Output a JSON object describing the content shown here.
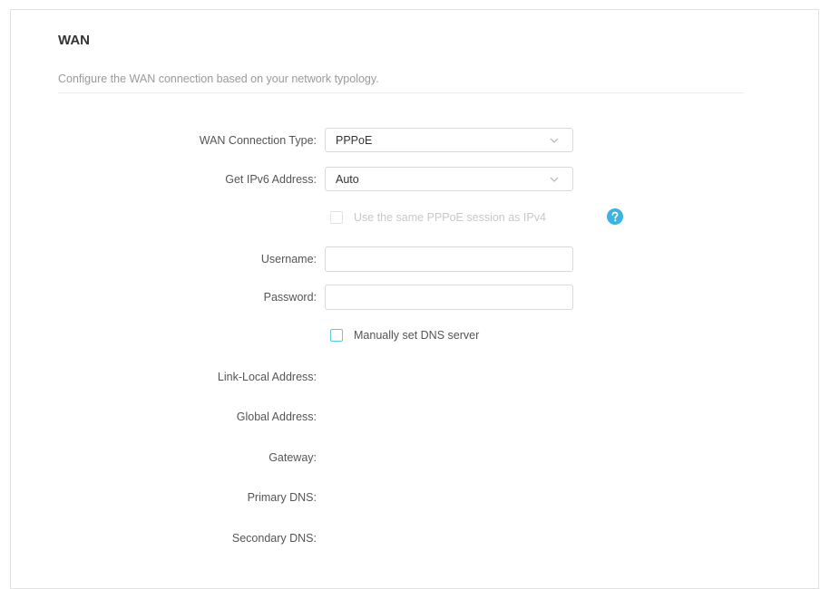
{
  "section": {
    "title": "WAN",
    "description": "Configure the WAN connection based on your network typology."
  },
  "form": {
    "connection_type": {
      "label": "WAN Connection Type:",
      "value": "PPPoE"
    },
    "ipv6_address": {
      "label": "Get IPv6 Address:",
      "value": "Auto"
    },
    "same_session": {
      "label": "Use the same PPPoE session as IPv4",
      "checked": false,
      "disabled": true
    },
    "username": {
      "label": "Username:",
      "value": ""
    },
    "password": {
      "label": "Password:",
      "value": ""
    },
    "manual_dns": {
      "label": "Manually set DNS server",
      "checked": false
    }
  },
  "status": {
    "link_local": {
      "label": "Link-Local Address:",
      "value": ""
    },
    "global": {
      "label": "Global Address:",
      "value": ""
    },
    "gateway": {
      "label": "Gateway:",
      "value": ""
    },
    "primary_dns": {
      "label": "Primary DNS:",
      "value": ""
    },
    "secondary_dns": {
      "label": "Secondary DNS:",
      "value": ""
    }
  },
  "colors": {
    "accent": "#5fc6e6",
    "help_icon": "#3bb4df",
    "label_text": "#555555",
    "muted_text": "#9a9a9a"
  },
  "icons": {
    "dropdown": "chevron-down-icon",
    "help": "question-mark-icon"
  }
}
